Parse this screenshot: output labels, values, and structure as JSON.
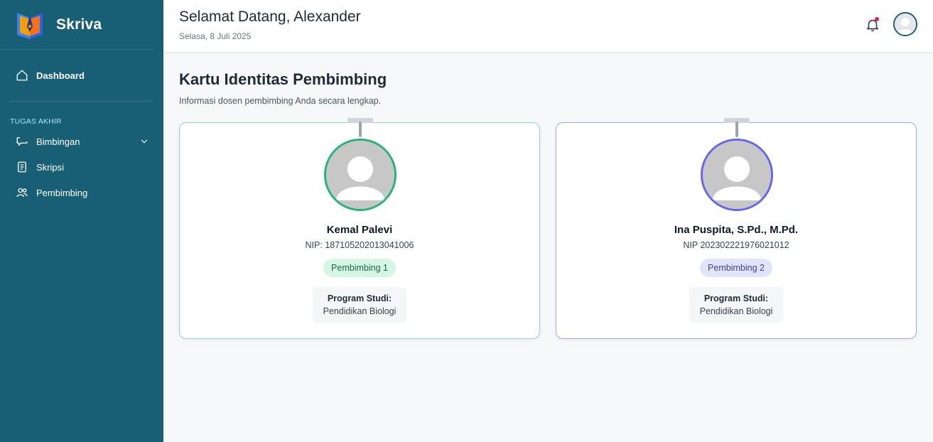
{
  "brand": {
    "name": "Skriva"
  },
  "sidebar": {
    "dashboard": "Dashboard",
    "section_label": "TUGAS AKHIR",
    "items": [
      {
        "label": "Bimbingan",
        "icon": "chat-icon"
      },
      {
        "label": "Skripsi",
        "icon": "document-icon"
      },
      {
        "label": "Pembimbing",
        "icon": "users-icon"
      }
    ]
  },
  "header": {
    "greeting": "Selamat Datang, Alexander",
    "date": "Selasa, 8 Juli 2025"
  },
  "main": {
    "title": "Kartu Identitas Pembimbing",
    "subtitle": "Informasi dosen pembimbing Anda secara lengkap."
  },
  "cards": [
    {
      "name": "Kemal Palevi",
      "nip": "NIP: 187105202013041006",
      "badge": "Pembimbing 1",
      "prodi_label": "Program Studi:",
      "prodi_value": "Pendidikan Biologi",
      "accent": "#22b57a"
    },
    {
      "name": "Ina Puspita, S.Pd., M.Pd.",
      "nip": "NIP 202302221976021012",
      "badge": "Pembimbing 2",
      "prodi_label": "Program Studi:",
      "prodi_value": "Pendidikan Biologi",
      "accent": "#6366f1"
    }
  ],
  "colors": {
    "sidebar": "#185f75",
    "notification_dot": "#e11d48"
  }
}
